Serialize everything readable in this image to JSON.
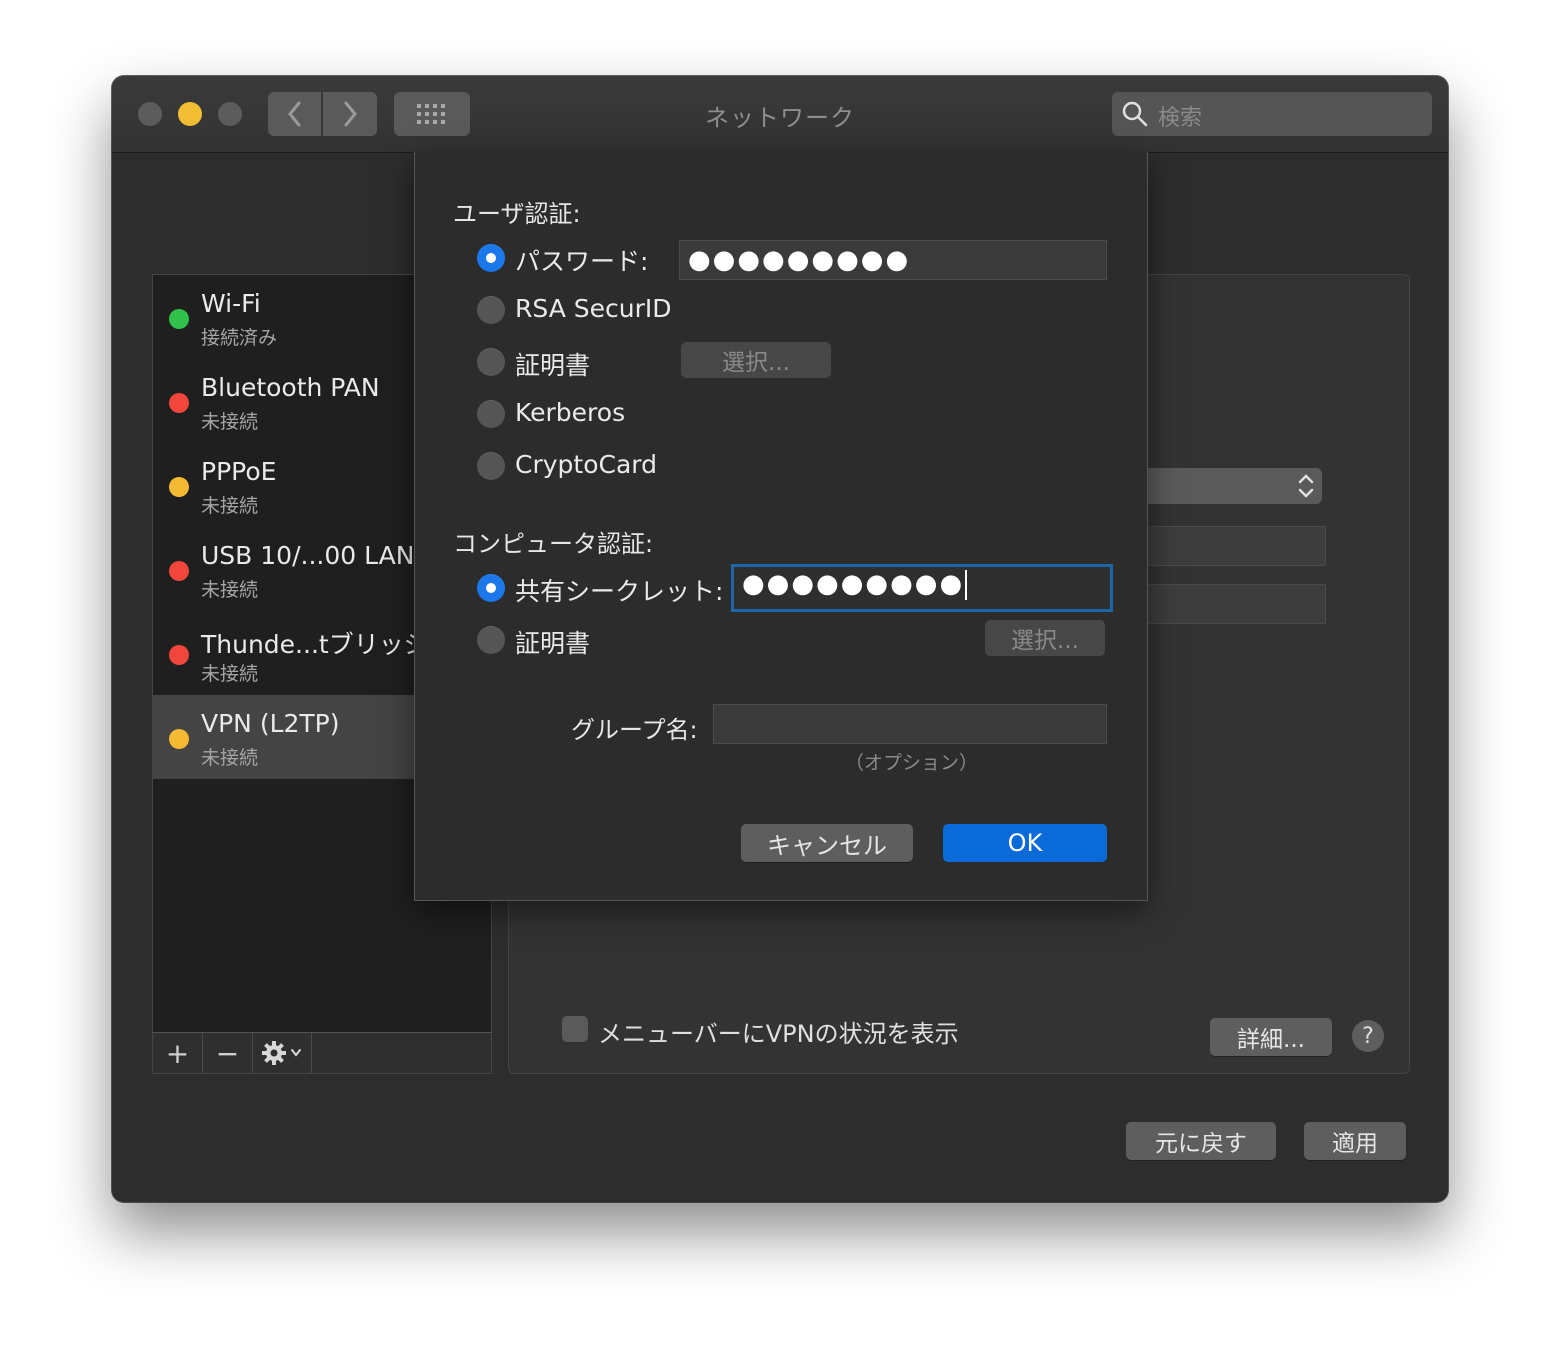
{
  "window": {
    "title": "ネットワーク",
    "search_placeholder": "検索"
  },
  "services": [
    {
      "name": "Wi-Fi",
      "status": "接続済み",
      "color": "#2fc149"
    },
    {
      "name": "Bluetooth PAN",
      "status": "未接続",
      "color": "#f2463d"
    },
    {
      "name": "PPPoE",
      "status": "未接続",
      "color": "#f5b932"
    },
    {
      "name": "USB 10/...00 LAN",
      "status": "未接続",
      "color": "#f2463d"
    },
    {
      "name": "Thunde...tブリッジ",
      "status": "未接続",
      "color": "#f2463d"
    },
    {
      "name": "VPN (L2TP)",
      "status": "未接続",
      "color": "#f5b932",
      "selected": true
    }
  ],
  "list_toolbar": {
    "add": "+",
    "remove": "−"
  },
  "sheet": {
    "user_auth_label": "ユーザ認証:",
    "user_auth_options": [
      {
        "label": "パスワード:",
        "selected": true
      },
      {
        "label": "RSA SecurID",
        "selected": false
      },
      {
        "label": "証明書",
        "selected": false
      },
      {
        "label": "Kerberos",
        "selected": false
      },
      {
        "label": "CryptoCard",
        "selected": false
      }
    ],
    "password_value": "●●●●●●●●●",
    "cert_select_label": "選択...",
    "computer_auth_label": "コンピュータ認証:",
    "computer_auth_options": [
      {
        "label": "共有シークレット:",
        "selected": true
      },
      {
        "label": "証明書",
        "selected": false
      }
    ],
    "shared_secret_value": "●●●●●●●●●",
    "cert2_select_label": "選択...",
    "group_name_label": "グループ名:",
    "group_name_value": "",
    "group_name_hint": "（オプション）",
    "cancel_label": "キャンセル",
    "ok_label": "OK"
  },
  "detail": {
    "show_vpn_status_label": "メニューバーにVPNの状況を表示",
    "show_vpn_status_checked": false,
    "advanced_label": "詳細...",
    "help_label": "?"
  },
  "footer": {
    "revert_label": "元に戻す",
    "apply_label": "適用"
  },
  "colors": {
    "accent": "#0a6bd8",
    "focus_ring": "#1a66a8"
  }
}
